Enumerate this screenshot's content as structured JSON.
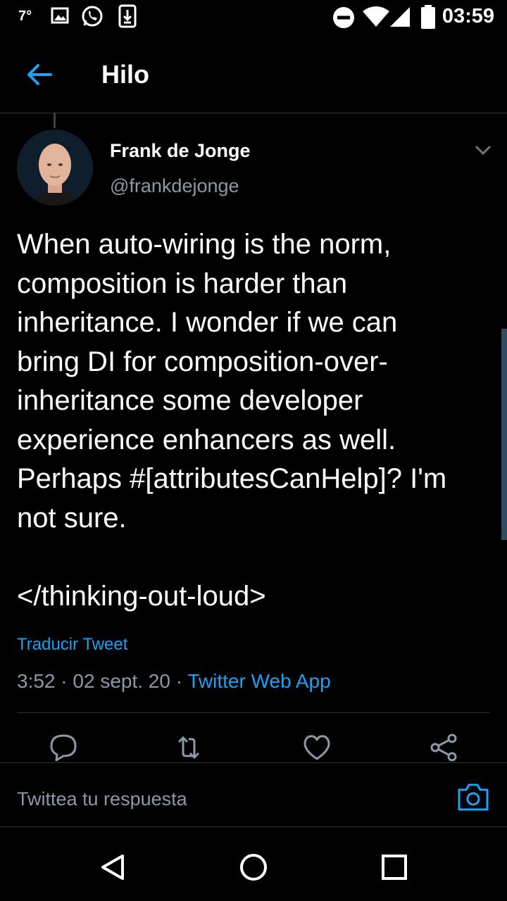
{
  "status_bar": {
    "temperature": "7°",
    "time": "03:59"
  },
  "app_bar": {
    "title": "Hilo",
    "back_icon": "arrow-left-icon"
  },
  "tweet": {
    "author_name": "Frank de Jonge",
    "handle": "@frankdejonge",
    "text": "When auto-wiring is the norm,\ncomposition is harder than\ninheritance. I wonder if we can\nbring DI for composition-over-\ninheritance some developer\nexperience enhancers as well.\nPerhaps #[attributesCanHelp]? I'm\nnot sure.\n\n</thinking-out-loud>",
    "translate_label": "Traducir Tweet",
    "time": "3:52",
    "date": "02 sept. 20",
    "source": "Twitter Web App",
    "separator": "·"
  },
  "reply": {
    "placeholder": "Twittea tu respuesta"
  },
  "colors": {
    "accent": "#1da1f2",
    "background": "#000000",
    "muted": "#8b98a5"
  }
}
